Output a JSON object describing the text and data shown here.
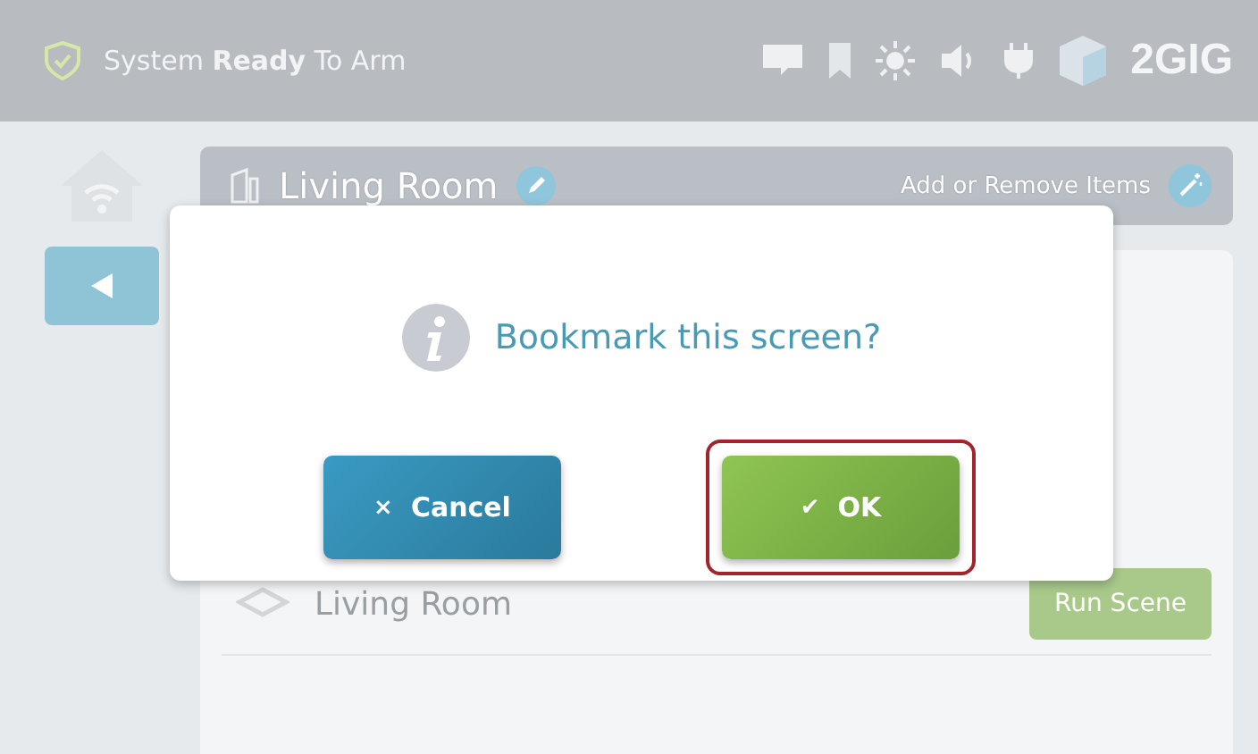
{
  "status_bar": {
    "status": "System **Ready** To Arm",
    "logo": "2GIG"
  },
  "room": {
    "title": "Living Room",
    "action": "Add or Remove Items"
  },
  "scene": {
    "name": "Living Room",
    "button": "Run Scene"
  },
  "dialog": {
    "message": "Bookmark this screen?",
    "buttons": [
      {
        "kind": "cancel",
        "label": "Cancel",
        "icon": "×",
        "selected": false
      },
      {
        "kind": "ok",
        "label": "OK",
        "icon": "✔",
        "selected": true
      }
    ]
  }
}
